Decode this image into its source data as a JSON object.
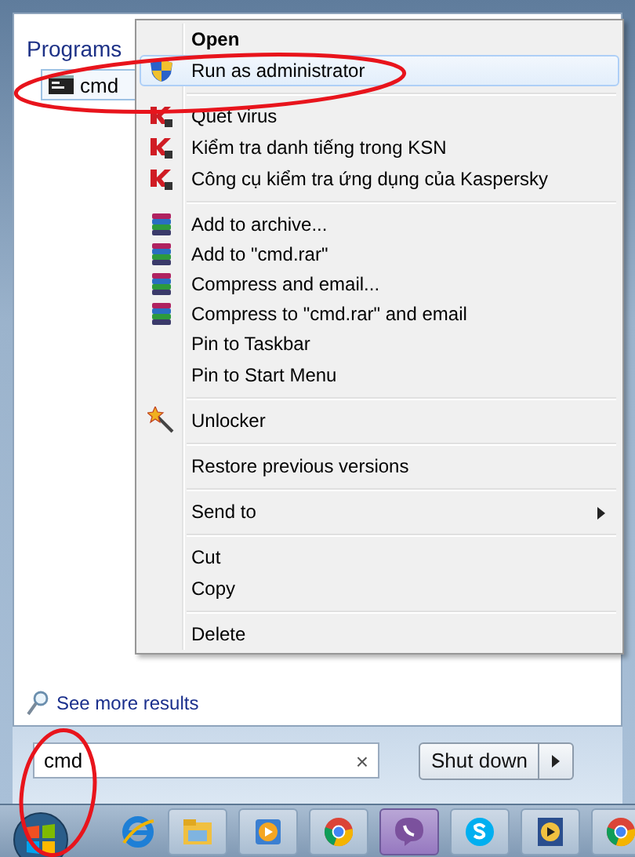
{
  "start_menu": {
    "programs_header": "Programs",
    "results": [
      {
        "label": "cmd",
        "kind": "console",
        "selected": true
      }
    ],
    "see_more": "See more results",
    "search": {
      "value": "cmd",
      "clear": "×",
      "circled": true
    },
    "shutdown": {
      "label": "Shut down"
    }
  },
  "context_menu": {
    "groups": [
      [
        {
          "label": "Open",
          "kind": "plain",
          "default": true,
          "selected": false,
          "submenu": false,
          "circled": false
        },
        {
          "label": "Run as administrator",
          "kind": "shield",
          "default": false,
          "selected": true,
          "submenu": false,
          "circled": true
        }
      ],
      [
        {
          "label": "Quét virus",
          "kind": "kaspersky",
          "default": false,
          "selected": false,
          "submenu": false,
          "circled": false
        },
        {
          "label": "Kiểm tra danh tiếng trong KSN",
          "kind": "kaspersky",
          "default": false,
          "selected": false,
          "submenu": false,
          "circled": false
        },
        {
          "label": "Công cụ kiểm tra ứng dụng của Kaspersky",
          "kind": "kaspersky",
          "default": false,
          "selected": false,
          "submenu": false,
          "circled": false
        }
      ],
      [
        {
          "label": "Add to archive...",
          "kind": "winrar",
          "default": false,
          "selected": false,
          "submenu": false,
          "circled": false
        },
        {
          "label": "Add to \"cmd.rar\"",
          "kind": "winrar",
          "default": false,
          "selected": false,
          "submenu": false,
          "circled": false
        },
        {
          "label": "Compress and email...",
          "kind": "winrar",
          "default": false,
          "selected": false,
          "submenu": false,
          "circled": false
        },
        {
          "label": "Compress to \"cmd.rar\" and email",
          "kind": "winrar",
          "default": false,
          "selected": false,
          "submenu": false,
          "circled": false
        },
        {
          "label": "Pin to Taskbar",
          "kind": "plain",
          "default": false,
          "selected": false,
          "submenu": false,
          "circled": false
        },
        {
          "label": "Pin to Start Menu",
          "kind": "plain",
          "default": false,
          "selected": false,
          "submenu": false,
          "circled": false
        }
      ],
      [
        {
          "label": "Unlocker",
          "kind": "wand",
          "default": false,
          "selected": false,
          "submenu": false,
          "circled": false
        }
      ],
      [
        {
          "label": "Restore previous versions",
          "kind": "plain",
          "default": false,
          "selected": false,
          "submenu": false,
          "circled": false
        }
      ],
      [
        {
          "label": "Send to",
          "kind": "plain",
          "default": false,
          "selected": false,
          "submenu": true,
          "circled": false
        }
      ],
      [
        {
          "label": "Cut",
          "kind": "plain",
          "default": false,
          "selected": false,
          "submenu": false,
          "circled": false
        },
        {
          "label": "Copy",
          "kind": "plain",
          "default": false,
          "selected": false,
          "submenu": false,
          "circled": false
        }
      ],
      [
        {
          "label": "Delete",
          "kind": "plain",
          "default": false,
          "selected": false,
          "submenu": false,
          "circled": false
        }
      ]
    ]
  },
  "taskbar": {
    "buttons": [
      {
        "kind": "ie",
        "selected": false
      },
      {
        "kind": "folder",
        "selected": false
      },
      {
        "kind": "player",
        "selected": false
      },
      {
        "kind": "chrome",
        "selected": false
      },
      {
        "kind": "viber",
        "selected": true
      },
      {
        "kind": "skype",
        "selected": false
      },
      {
        "kind": "media",
        "selected": false
      },
      {
        "kind": "chrome",
        "selected": false
      }
    ]
  }
}
